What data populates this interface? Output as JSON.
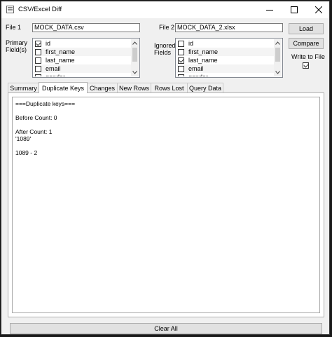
{
  "window": {
    "title": "CSV/Excel Diff"
  },
  "file1": {
    "label": "File 1",
    "value": "MOCK_DATA.csv"
  },
  "file2": {
    "label": "File 2",
    "value": "MOCK_DATA_2.xlsx"
  },
  "buttons": {
    "load": "Load",
    "compare": "Compare",
    "clear_all": "Clear All"
  },
  "primary_fields": {
    "label_line1": "Primary",
    "label_line2": "Field(s)",
    "items": [
      {
        "label": "id",
        "checked": true
      },
      {
        "label": "first_name",
        "checked": false
      },
      {
        "label": "last_name",
        "checked": false
      },
      {
        "label": "email",
        "checked": false
      },
      {
        "label": "gender",
        "checked": false
      }
    ]
  },
  "ignored_fields": {
    "label_line1": "Ignored",
    "label_line2": "Fields",
    "items": [
      {
        "label": "id",
        "checked": false
      },
      {
        "label": "first_name",
        "checked": false
      },
      {
        "label": "last_name",
        "checked": true
      },
      {
        "label": "email",
        "checked": false
      },
      {
        "label": "gender",
        "checked": false
      }
    ]
  },
  "write_to_file": {
    "label": "Write to File",
    "checked": true
  },
  "tabs": [
    {
      "label": "Summary",
      "active": false
    },
    {
      "label": "Duplicate Keys",
      "active": true
    },
    {
      "label": "Changes",
      "active": false
    },
    {
      "label": "New Rows",
      "active": false
    },
    {
      "label": "Rows Lost",
      "active": false
    },
    {
      "label": "Query Data",
      "active": false
    }
  ],
  "output": {
    "lines": [
      "===Duplicate keys===",
      "",
      "Before Count: 0",
      "",
      "After Count: 1",
      "'1089'",
      "",
      "1089 - 2"
    ]
  }
}
